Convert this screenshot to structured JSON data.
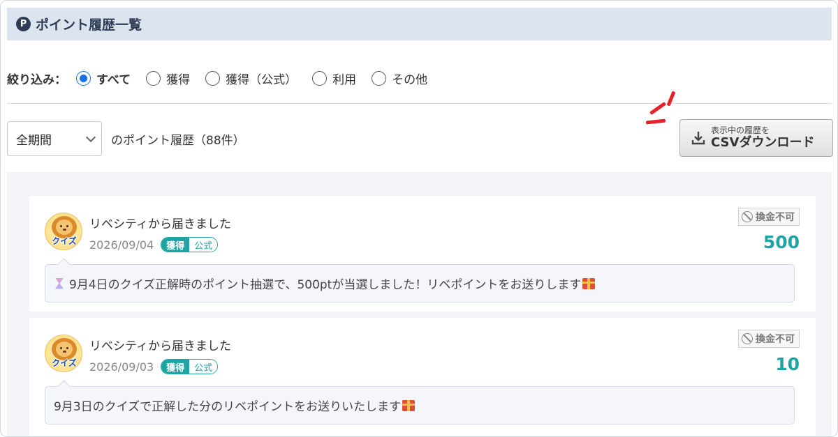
{
  "header": {
    "icon_letter": "P",
    "title": "ポイント履歴一覧"
  },
  "filter": {
    "label": "絞り込み：",
    "options": [
      {
        "label": "すべて",
        "checked": true
      },
      {
        "label": "獲得",
        "checked": false
      },
      {
        "label": "獲得（公式）",
        "checked": false
      },
      {
        "label": "利用",
        "checked": false
      },
      {
        "label": "その他",
        "checked": false
      }
    ]
  },
  "period": {
    "selected": "全期間",
    "count_text": "のポイント履歴（88件）"
  },
  "csv_button": {
    "line1": "表示中の履歴を",
    "line2": "CSVダウンロード"
  },
  "colors": {
    "accent": "#1ea4a4",
    "header_bg": "#dce4f0",
    "radio": "#1a73e8",
    "emphasis": "#e8202a"
  },
  "items": [
    {
      "avatar_label": "クイズ",
      "title": "リベシティから届きました",
      "date": "2026/09/04",
      "tag_primary": "獲得",
      "tag_secondary": "公式",
      "status": "換金不可",
      "points": "500",
      "message": "9月4日のクイズ正解時のポイント抽選で、500ptが当選しました！リベポイントをお送りします"
    },
    {
      "avatar_label": "クイズ",
      "title": "リベシティから届きました",
      "date": "2026/09/03",
      "tag_primary": "獲得",
      "tag_secondary": "公式",
      "status": "換金不可",
      "points": "10",
      "message": "9月3日のクイズで正解した分のリベポイントをお送りいたします"
    }
  ]
}
